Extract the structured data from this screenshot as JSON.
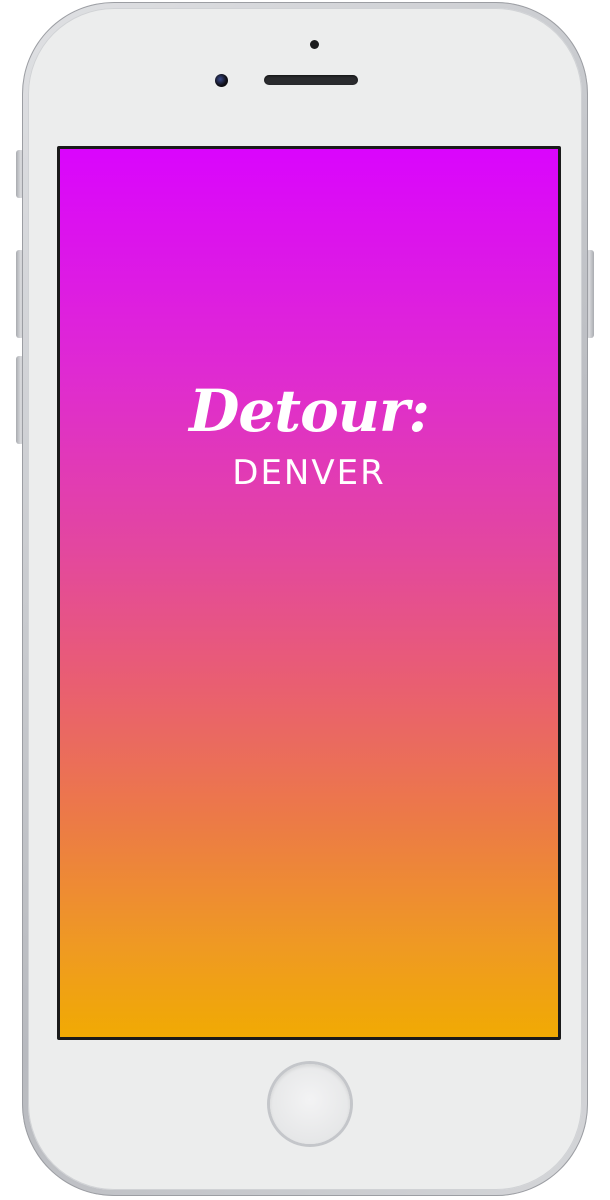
{
  "app": {
    "logo_text": "Detour:",
    "city_text": "DENVER"
  },
  "colors": {
    "gradient_top": "#da05fd",
    "gradient_bottom": "#f1aa03",
    "text": "#ffffff",
    "device_body": "#eceded"
  },
  "device": {
    "model": "smartphone",
    "icons": [
      "speaker-dot-icon",
      "front-camera-icon",
      "earpiece-speaker-icon",
      "home-button-icon"
    ]
  }
}
